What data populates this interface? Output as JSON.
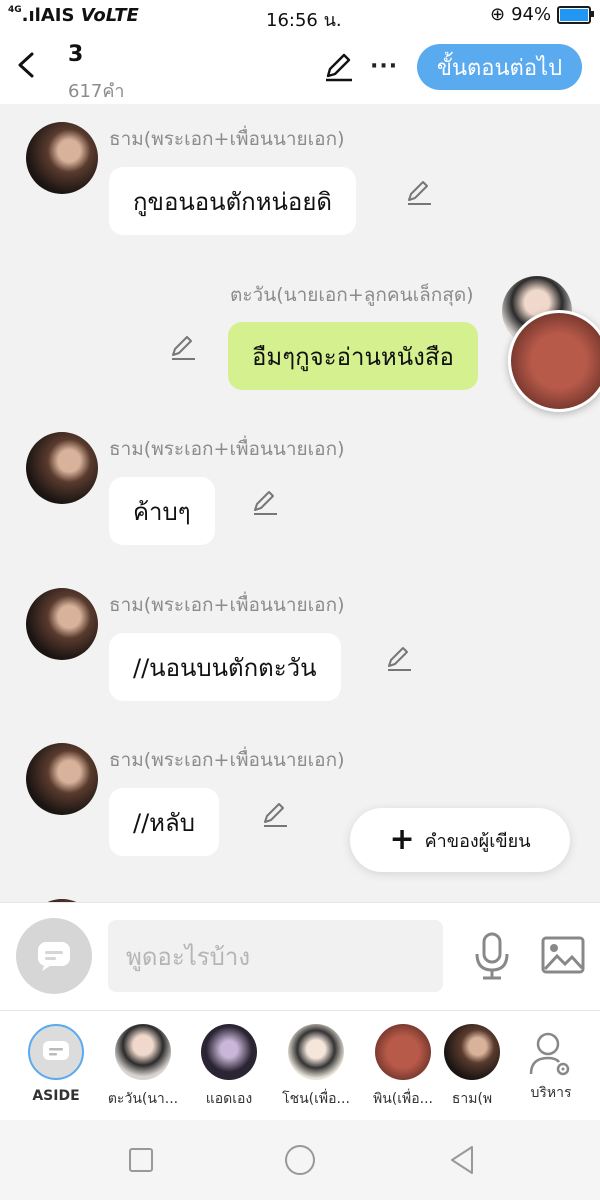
{
  "status_bar": {
    "network": "4G",
    "carrier": "AIS",
    "volte": "VoLTE",
    "time": "16:56 น.",
    "battery": "94%",
    "battery_level": 0.94
  },
  "header": {
    "title": "3",
    "word_count": "617คำ",
    "next_button": "ขั้นตอนต่อไป",
    "more_label": "···"
  },
  "messages": [
    {
      "sender": "ธาม(พระเอก+เพื่อนนายเอก)",
      "text": "กูขอนอนตักหน่อยดิ",
      "side": "left"
    },
    {
      "sender": "ตะวัน(นายเอก+ลูกคนเล็กสุด)",
      "text": "อืมๆกูจะอ่านหนังสือ",
      "side": "right"
    },
    {
      "sender": "ธาม(พระเอก+เพื่อนนายเอก)",
      "text": "ค้าบๆ",
      "side": "left"
    },
    {
      "sender": "ธาม(พระเอก+เพื่อนนายเอก)",
      "text": "//นอนบนตักตะวัน",
      "side": "left"
    },
    {
      "sender": "ธาม(พระเอก+เพื่อนนายเอก)",
      "text": "//หลับ",
      "side": "left"
    }
  ],
  "writer_button": {
    "label": "คำของผู้เขียน",
    "icon": "+"
  },
  "input": {
    "placeholder": "พูดอะไรบ้าง"
  },
  "characters": [
    {
      "label": "ASIDE"
    },
    {
      "label": "ตะวัน(นา..."
    },
    {
      "label": "แอดเอง"
    },
    {
      "label": "โชน(เพื่อ..."
    },
    {
      "label": "พิน(เพื่อ..."
    },
    {
      "label": "ธาม(พ"
    },
    {
      "label": "บริหาร"
    }
  ],
  "colors": {
    "accent": "#5aaaf0",
    "my_bubble": "#d5f08e",
    "background": "#f2f2f2"
  }
}
